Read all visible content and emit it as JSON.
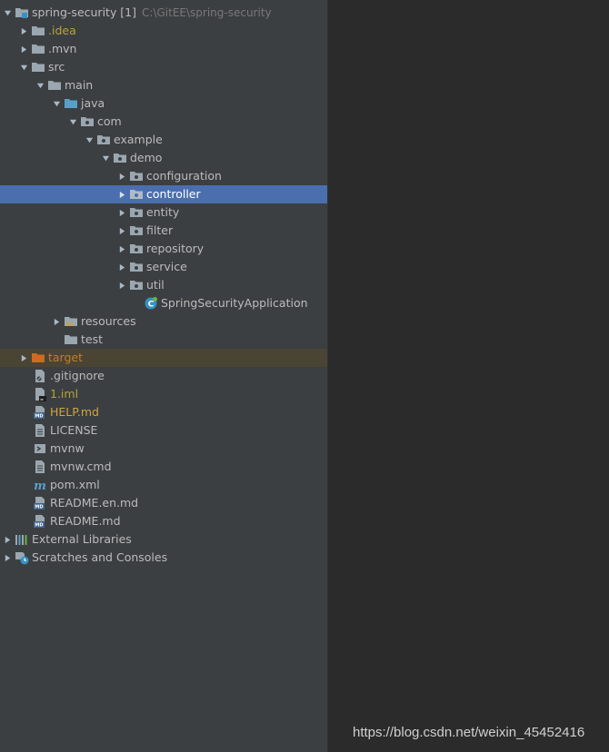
{
  "project": {
    "name": "spring-security [1]",
    "path": "C:\\GitEE\\spring-security"
  },
  "tree": {
    "idea": ".idea",
    "mvn": ".mvn",
    "src": "src",
    "main": "main",
    "java": "java",
    "com": "com",
    "example": "example",
    "demo": "demo",
    "configuration": "configuration",
    "controller": "controller",
    "entity": "entity",
    "filter": "filter",
    "repository": "repository",
    "service": "service",
    "util": "util",
    "app_class": "SpringSecurityApplication",
    "resources": "resources",
    "test": "test",
    "target": "target",
    "gitignore": ".gitignore",
    "iml": "1.iml",
    "help": "HELP.md",
    "license": "LICENSE",
    "mvnw": "mvnw",
    "mvnw_cmd": "mvnw.cmd",
    "pom": "pom.xml",
    "readme_en": "README.en.md",
    "readme": "README.md",
    "external_libraries": "External Libraries",
    "scratches": "Scratches and Consoles"
  },
  "selected_item": "controller",
  "watermark": "https://blog.csdn.net/weixin_45452416",
  "colors": {
    "panel_bg": "#3c3f41",
    "editor_bg": "#2b2b2b",
    "selection": "#4b6eaf",
    "folder": "#9aa7b0",
    "source_folder": "#5a9fc9",
    "excluded_folder": "#d2691e",
    "ignored_text": "#b4a43d"
  }
}
